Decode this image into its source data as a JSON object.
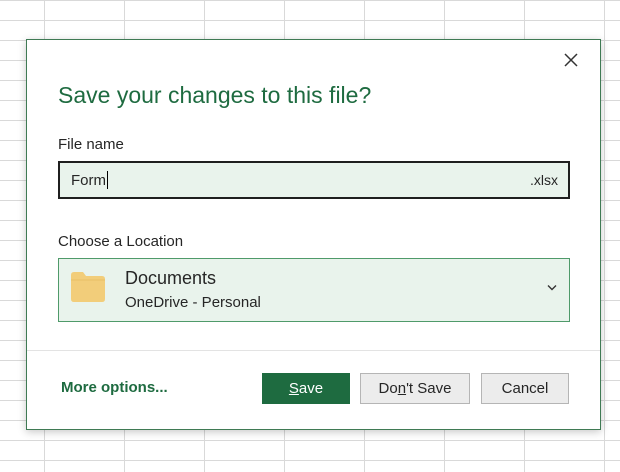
{
  "dialog": {
    "title": "Save your changes to this file?",
    "close_icon": "close-icon",
    "file_name": {
      "label": "File name",
      "value": "Form",
      "extension": ".xlsx"
    },
    "location": {
      "label": "Choose a Location",
      "icon": "folder-icon",
      "name": "Documents",
      "subtitle": "OneDrive - Personal",
      "dropdown_icon": "chevron-down-icon"
    },
    "more_options": "More options...",
    "buttons": {
      "save": {
        "before": "",
        "mnemonic": "S",
        "after": "ave"
      },
      "dont_save": {
        "before": "Do",
        "mnemonic": "n",
        "after": "'t Save"
      },
      "cancel": "Cancel"
    }
  },
  "colors": {
    "accent": "#1e6b40",
    "field_background": "#e9f3ec",
    "folder": "#f2cd7a",
    "dialog_border": "#3f7a54",
    "gridlines": "#d9d9d9"
  }
}
